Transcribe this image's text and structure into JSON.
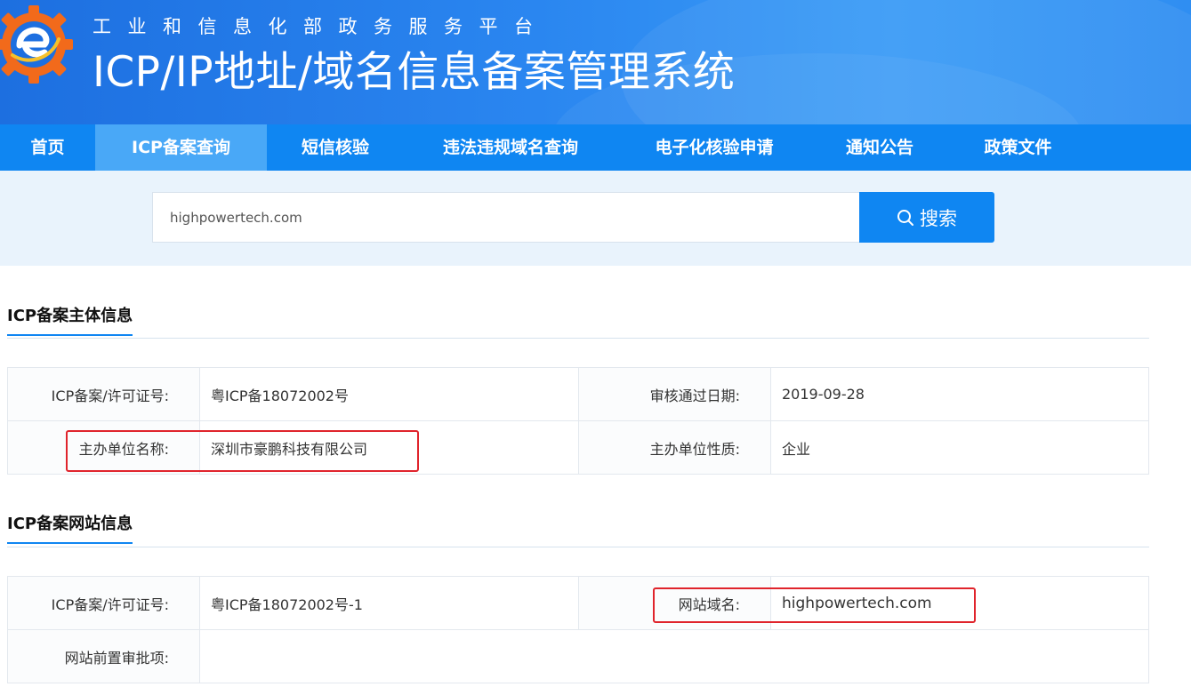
{
  "header": {
    "subtitle": "工业和信息化部政务服务平台",
    "title": "ICP/IP地址/域名信息备案管理系统"
  },
  "nav": {
    "items": [
      {
        "label": "首页"
      },
      {
        "label": "ICP备案查询"
      },
      {
        "label": "短信核验"
      },
      {
        "label": "违法违规域名查询"
      },
      {
        "label": "电子化核验申请"
      },
      {
        "label": "通知公告"
      },
      {
        "label": "政策文件"
      }
    ],
    "active_index": 1
  },
  "search": {
    "value": "highpowertech.com",
    "button_label": "搜索",
    "button_icon": "search-icon"
  },
  "subject_section": {
    "title": "ICP备案主体信息",
    "rows": [
      {
        "label1": "ICP备案/许可证号:",
        "value1": "粤ICP备18072002号",
        "label2": "审核通过日期:",
        "value2": "2019-09-28"
      },
      {
        "label1": "主办单位名称:",
        "value1": "深圳市豪鹏科技有限公司",
        "label2": "主办单位性质:",
        "value2": "企业"
      }
    ]
  },
  "website_section": {
    "title": "ICP备案网站信息",
    "rows": [
      {
        "label1": "ICP备案/许可证号:",
        "value1": "粤ICP备18072002号-1",
        "label2": "网站域名:",
        "value2": "highpowertech.com"
      },
      {
        "label1": "网站前置审批项:",
        "value1": ""
      }
    ]
  },
  "colors": {
    "primary": "#0f86f2",
    "nav_active": "#49a8f7",
    "highlight_box": "#e0242c",
    "search_band": "#e9f3fc"
  }
}
